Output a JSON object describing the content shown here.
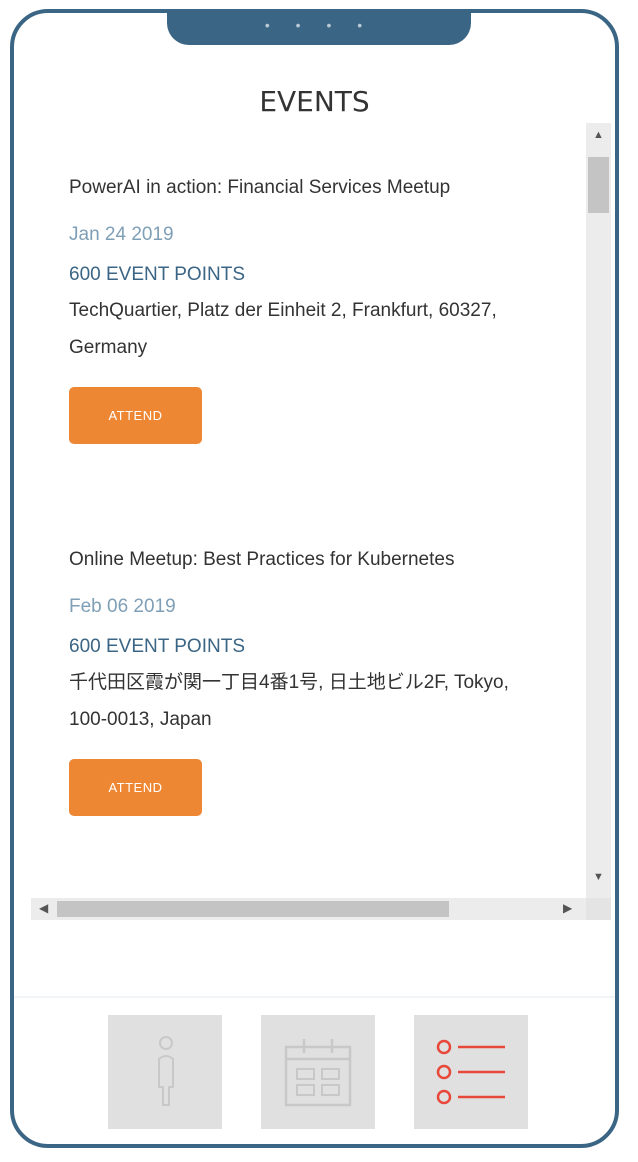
{
  "header": {
    "title": "EVENTS",
    "notch_dots": "• • • •"
  },
  "events": [
    {
      "title": "PowerAI in action: Financial Services Meetup",
      "date": "Jan 24 2019",
      "points": "600 EVENT POINTS",
      "address": "TechQuartier, Platz der Einheit 2, Frankfurt, 60327, Germany",
      "button_label": "ATTEND"
    },
    {
      "title": "Online Meetup: Best Practices for Kubernetes",
      "date": "Feb 06 2019",
      "points": "600 EVENT POINTS",
      "address": "千代田区霞が関一丁目4番1号, 日土地ビル2F, Tokyo, 100-0013, Japan",
      "button_label": "ATTEND"
    }
  ],
  "nav": {
    "items": [
      {
        "icon": "person-icon",
        "active": false
      },
      {
        "icon": "calendar-icon",
        "active": false
      },
      {
        "icon": "list-icon",
        "active": true
      }
    ]
  },
  "colors": {
    "frame": "#3b6584",
    "date": "#7f9fb6",
    "points": "#3b6584",
    "button": "#ee8733",
    "active_icon": "#e8483a",
    "inactive_icon": "#c8c8c8"
  }
}
